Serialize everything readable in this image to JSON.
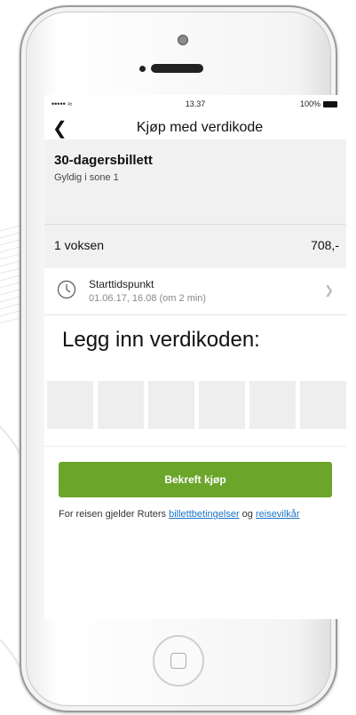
{
  "status_bar": {
    "signal": "••••• ≈",
    "time": "13.37",
    "battery": "100%"
  },
  "nav": {
    "back_icon": "chevron-left",
    "title": "Kjøp med verdikode"
  },
  "ticket": {
    "title": "30-dagersbillett",
    "subtitle": "Gyldig i sone 1"
  },
  "price": {
    "label": "1 voksen",
    "value": "708,-"
  },
  "start_time": {
    "label": "Starttidspunkt",
    "value": "01.06.17, 16.08 (om 2 min)"
  },
  "code": {
    "prompt": "Legg inn verdikoden:",
    "box_count": 6
  },
  "confirm_button": "Bekreft kjøp",
  "terms": {
    "text_before": "For reisen gjelder Ruters ",
    "link1": "billettbetingelser",
    "text_between": " og ",
    "link2": "reisevilkår"
  },
  "colors": {
    "accent": "#6ba52a",
    "link": "#1a73c8",
    "panel": "#f1f1f1"
  }
}
